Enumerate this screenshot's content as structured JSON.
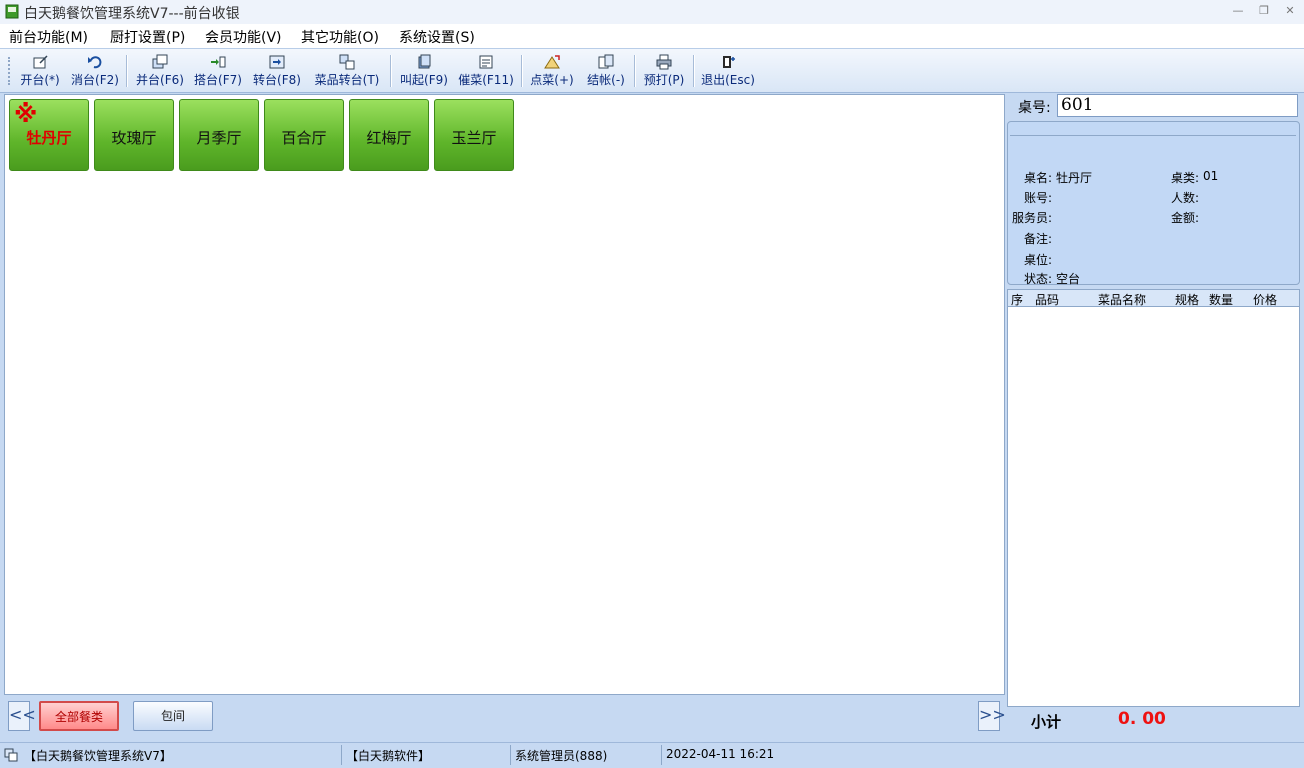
{
  "window": {
    "title": "白天鹅餐饮管理系统V7---前台收银"
  },
  "menu": [
    "前台功能(M)",
    "厨打设置(P)",
    "会员功能(V)",
    "其它功能(O)",
    "系统设置(S)"
  ],
  "toolbar": [
    {
      "label": "开台(*)",
      "icon": "open-table-icon"
    },
    {
      "label": "消台(F2)",
      "icon": "undo-icon"
    },
    {
      "label": "并台(F6)",
      "icon": "merge-table-icon"
    },
    {
      "label": "搭台(F7)",
      "icon": "share-table-icon"
    },
    {
      "label": "转台(F8)",
      "icon": "transfer-table-icon"
    },
    {
      "label": "菜品转台(T)",
      "icon": "transfer-dish-icon"
    },
    {
      "label": "叫起(F9)",
      "icon": "hold-icon"
    },
    {
      "label": "催菜(F11)",
      "icon": "hurry-icon"
    },
    {
      "label": "点菜(+)",
      "icon": "order-icon"
    },
    {
      "label": "结帐(-)",
      "icon": "checkout-icon"
    },
    {
      "label": "预打(P)",
      "icon": "printer-icon"
    },
    {
      "label": "退出(Esc)",
      "icon": "exit-icon"
    }
  ],
  "rooms": {
    "mark": "※",
    "items": [
      "牡丹厅",
      "玫瑰厅",
      "月季厅",
      "百合厅",
      "红梅厅",
      "玉兰厅"
    ]
  },
  "categories": {
    "prev": "<<",
    "next": ">>",
    "items": [
      "全部餐类",
      "包间"
    ]
  },
  "table_panel": {
    "table_no_label": "桌号:",
    "table_no_value": "601",
    "fields": {
      "name_label": "桌名:",
      "name_value": "牡丹厅",
      "type_label": "桌类:",
      "type_value": "01",
      "account_label": "账号:",
      "people_label": "人数:",
      "waiter_label": "服务员:",
      "amount_label": "金额:",
      "remark_label": "备注:",
      "seat_label": "桌位:",
      "status_label": "状态:",
      "status_value": "空台"
    },
    "columns": [
      "序",
      "品码",
      "菜品名称",
      "规格",
      "数量",
      "价格"
    ],
    "subtotal_label": "小计",
    "subtotal_value": "0. 00"
  },
  "status_bar": {
    "product": "【白天鹅餐饮管理系统V7】",
    "company": "【白天鹅软件】",
    "user": "系统管理员(888)",
    "datetime": "2022-04-11 16:21"
  },
  "colors": {
    "room_green": "#5fb52a",
    "active_red": "#e00000",
    "panel_blue": "#c6d9f2",
    "subtotal_red": "#ee1111"
  }
}
